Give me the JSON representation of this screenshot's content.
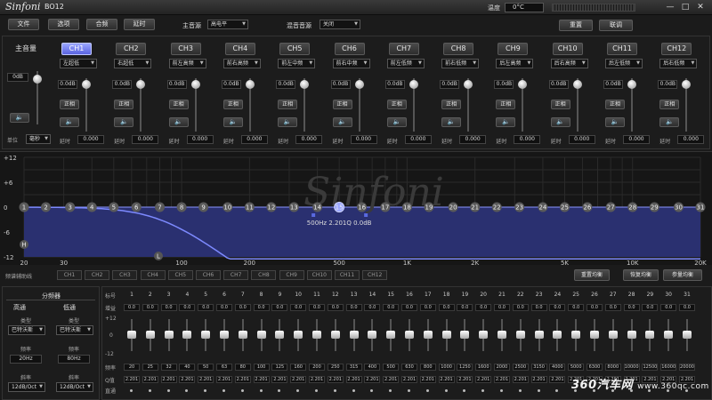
{
  "titlebar": {
    "logo": "Sinfoni",
    "model": "BO12",
    "temp_label": "温度",
    "temp_value": "0°C",
    "min": "—",
    "max": "□",
    "close": "✕"
  },
  "menu": {
    "file": "文件",
    "options": "选项",
    "presets": "合频",
    "delay": "延时",
    "main_source_label": "主音源",
    "main_source_value": "高电平",
    "mix_source_label": "混音音源",
    "mix_source_value": "关闭",
    "reset": "重置",
    "link": "联调"
  },
  "master": {
    "label": "主音量",
    "value": "0dB",
    "unit_label": "单位",
    "unit_value": "毫秒",
    "mute": "🔈"
  },
  "channels": [
    {
      "name": "CH1",
      "pos": "左超低",
      "gain": "0.0dB",
      "phase": "正相",
      "delay": "0.000",
      "active": true
    },
    {
      "name": "CH2",
      "pos": "右超低",
      "gain": "0.0dB",
      "phase": "正相",
      "delay": "0.000"
    },
    {
      "name": "CH3",
      "pos": "前左高频",
      "gain": "0.0dB",
      "phase": "正相",
      "delay": "0.000"
    },
    {
      "name": "CH4",
      "pos": "前右高频",
      "gain": "0.0dB",
      "phase": "正相",
      "delay": "0.000"
    },
    {
      "name": "CH5",
      "pos": "前左中频",
      "gain": "0.0dB",
      "phase": "正相",
      "delay": "0.000"
    },
    {
      "name": "CH6",
      "pos": "前右中频",
      "gain": "0.0dB",
      "phase": "正相",
      "delay": "0.000"
    },
    {
      "name": "CH7",
      "pos": "前左低频",
      "gain": "0.0dB",
      "phase": "正相",
      "delay": "0.000"
    },
    {
      "name": "CH8",
      "pos": "前右低频",
      "gain": "0.0dB",
      "phase": "正相",
      "delay": "0.000"
    },
    {
      "name": "CH9",
      "pos": "后左高频",
      "gain": "0.0dB",
      "phase": "正相",
      "delay": "0.000"
    },
    {
      "name": "CH10",
      "pos": "后右高频",
      "gain": "0.0dB",
      "phase": "正相",
      "delay": "0.000"
    },
    {
      "name": "CH11",
      "pos": "后左低频",
      "gain": "0.0dB",
      "phase": "正相",
      "delay": "0.000"
    },
    {
      "name": "CH12",
      "pos": "后右低频",
      "gain": "0.0dB",
      "phase": "正相",
      "delay": "0.000"
    }
  ],
  "channel_labels": {
    "delay": "延时"
  },
  "graph": {
    "watermark": "Sinfoni",
    "y_ticks": [
      "+12",
      "+6",
      "0",
      "-6",
      "-12"
    ],
    "x_ticks": [
      "20",
      "30",
      "100",
      "200",
      "500",
      "1K",
      "2K",
      "5K",
      "10K",
      "20K"
    ],
    "nodes": [
      "1",
      "2",
      "3",
      "4",
      "5",
      "6",
      "7",
      "8",
      "9",
      "10",
      "11",
      "12",
      "13",
      "14",
      "15",
      "16",
      "17",
      "18",
      "19",
      "20",
      "21",
      "22",
      "23",
      "24",
      "25",
      "26",
      "27",
      "28",
      "29",
      "30",
      "31"
    ],
    "selected_node": "15",
    "info": {
      "freq": "500Hz",
      "q": "2.201Q",
      "gain": "0.0dB"
    },
    "marker_h": "H",
    "marker_l": "L"
  },
  "curve_row": {
    "label": "频谱辅助线",
    "channels": [
      "CH1",
      "CH2",
      "CH3",
      "CH4",
      "CH5",
      "CH6",
      "CH7",
      "CH8",
      "CH9",
      "CH10",
      "CH11",
      "CH12"
    ],
    "reset_eq": "重置均衡",
    "restore_eq": "恢复均衡",
    "bypass_eq": "参量均衡"
  },
  "crossover": {
    "title": "分频器",
    "high": "高通",
    "low": "低通",
    "type_label": "类型",
    "high_type": "巴特沃斯",
    "low_type": "巴特沃斯",
    "freq_label": "频率",
    "high_freq": "20Hz",
    "low_freq": "80Hz",
    "slope_label": "斜率",
    "high_slope": "12dB/Oct",
    "low_slope": "12dB/Oct"
  },
  "eq": {
    "labels": {
      "num": "标号",
      "gain": "增益",
      "freq": "频率",
      "q": "Q值",
      "bypass": "直通"
    },
    "scale": [
      "+12",
      "0",
      "-12"
    ],
    "bands": [
      "1",
      "2",
      "3",
      "4",
      "5",
      "6",
      "7",
      "8",
      "9",
      "10",
      "11",
      "12",
      "13",
      "14",
      "15",
      "16",
      "17",
      "18",
      "19",
      "20",
      "21",
      "22",
      "23",
      "24",
      "25",
      "26",
      "27",
      "28",
      "29",
      "30",
      "31"
    ],
    "gains": [
      "0.0",
      "0.0",
      "0.0",
      "0.0",
      "0.0",
      "0.0",
      "0.0",
      "0.0",
      "0.0",
      "0.0",
      "0.0",
      "0.0",
      "0.0",
      "0.0",
      "0.0",
      "0.0",
      "0.0",
      "0.0",
      "0.0",
      "0.0",
      "0.0",
      "0.0",
      "0.0",
      "0.0",
      "0.0",
      "0.0",
      "0.0",
      "0.0",
      "0.0",
      "0.0",
      "0.0"
    ],
    "freqs": [
      "20",
      "25",
      "32",
      "40",
      "50",
      "63",
      "80",
      "100",
      "125",
      "160",
      "200",
      "250",
      "315",
      "400",
      "500",
      "630",
      "800",
      "1000",
      "1250",
      "1600",
      "2000",
      "2500",
      "3150",
      "4000",
      "5000",
      "6300",
      "8000",
      "10000",
      "12500",
      "16000",
      "20000"
    ],
    "qs": [
      "2.201",
      "2.201",
      "2.201",
      "2.201",
      "2.201",
      "2.201",
      "2.201",
      "2.201",
      "2.201",
      "2.201",
      "2.201",
      "2.201",
      "2.201",
      "2.201",
      "2.201",
      "2.201",
      "2.201",
      "2.201",
      "2.201",
      "2.201",
      "2.201",
      "2.201",
      "2.201",
      "2.201",
      "2.201",
      "2.201",
      "2.201",
      "2.201",
      "2.201",
      "2.201",
      "2.201"
    ]
  },
  "watermark": {
    "brand": "360汽车网",
    "url": "www.360qc.com"
  }
}
